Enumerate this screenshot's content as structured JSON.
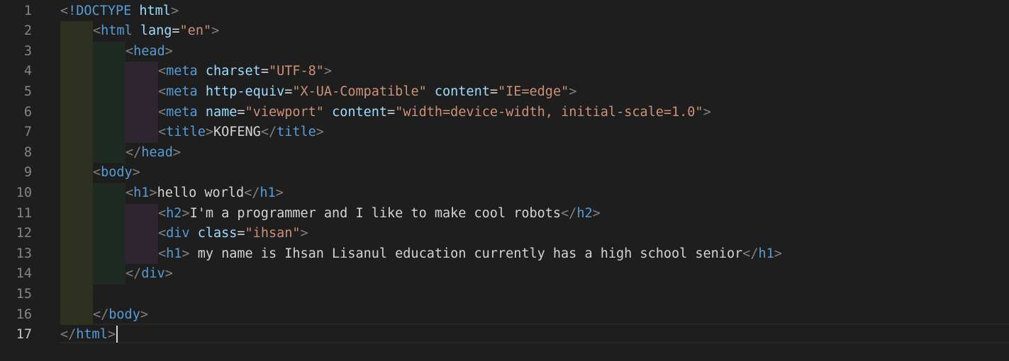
{
  "editor": {
    "line_numbers": [
      "1",
      "2",
      "3",
      "4",
      "5",
      "6",
      "7",
      "8",
      "9",
      "10",
      "11",
      "12",
      "13",
      "14",
      "15",
      "16",
      "17"
    ],
    "active_line": 17,
    "lines": [
      {
        "indent": 0,
        "tokens": [
          [
            "punc",
            "<"
          ],
          [
            "tag",
            "!DOCTYPE"
          ],
          [
            "text",
            " "
          ],
          [
            "attr",
            "html"
          ],
          [
            "punc",
            ">"
          ]
        ]
      },
      {
        "indent": 1,
        "tokens": [
          [
            "punc",
            "<"
          ],
          [
            "tag",
            "html"
          ],
          [
            "text",
            " "
          ],
          [
            "attr",
            "lang"
          ],
          [
            "text",
            "="
          ],
          [
            "str",
            "\"en\""
          ],
          [
            "punc",
            ">"
          ]
        ]
      },
      {
        "indent": 2,
        "tokens": [
          [
            "punc",
            "<"
          ],
          [
            "tag",
            "head"
          ],
          [
            "punc",
            ">"
          ]
        ]
      },
      {
        "indent": 3,
        "tokens": [
          [
            "punc",
            "<"
          ],
          [
            "tag",
            "meta"
          ],
          [
            "text",
            " "
          ],
          [
            "attr",
            "charset"
          ],
          [
            "text",
            "="
          ],
          [
            "str",
            "\"UTF-8\""
          ],
          [
            "punc",
            ">"
          ]
        ]
      },
      {
        "indent": 3,
        "tokens": [
          [
            "punc",
            "<"
          ],
          [
            "tag",
            "meta"
          ],
          [
            "text",
            " "
          ],
          [
            "attr",
            "http-equiv"
          ],
          [
            "text",
            "="
          ],
          [
            "str",
            "\"X-UA-Compatible\""
          ],
          [
            "text",
            " "
          ],
          [
            "attr",
            "content"
          ],
          [
            "text",
            "="
          ],
          [
            "str",
            "\"IE=edge\""
          ],
          [
            "punc",
            ">"
          ]
        ]
      },
      {
        "indent": 3,
        "tokens": [
          [
            "punc",
            "<"
          ],
          [
            "tag",
            "meta"
          ],
          [
            "text",
            " "
          ],
          [
            "attr",
            "name"
          ],
          [
            "text",
            "="
          ],
          [
            "str",
            "\"viewport\""
          ],
          [
            "text",
            " "
          ],
          [
            "attr",
            "content"
          ],
          [
            "text",
            "="
          ],
          [
            "str",
            "\"width=device-width, initial-scale=1.0\""
          ],
          [
            "punc",
            ">"
          ]
        ]
      },
      {
        "indent": 3,
        "tokens": [
          [
            "punc",
            "<"
          ],
          [
            "tag",
            "title"
          ],
          [
            "punc",
            ">"
          ],
          [
            "text",
            "KOFENG"
          ],
          [
            "punc",
            "</"
          ],
          [
            "tag",
            "title"
          ],
          [
            "punc",
            ">"
          ]
        ]
      },
      {
        "indent": 2,
        "tokens": [
          [
            "punc",
            "</"
          ],
          [
            "tag",
            "head"
          ],
          [
            "punc",
            ">"
          ]
        ]
      },
      {
        "indent": 1,
        "tokens": [
          [
            "punc",
            "<"
          ],
          [
            "tag",
            "body"
          ],
          [
            "punc",
            ">"
          ]
        ]
      },
      {
        "indent": 2,
        "tokens": [
          [
            "punc",
            "<"
          ],
          [
            "tag",
            "h1"
          ],
          [
            "punc",
            ">"
          ],
          [
            "text",
            "hello world"
          ],
          [
            "punc",
            "</"
          ],
          [
            "tag",
            "h1"
          ],
          [
            "punc",
            ">"
          ]
        ]
      },
      {
        "indent": 3,
        "tokens": [
          [
            "punc",
            "<"
          ],
          [
            "tag",
            "h2"
          ],
          [
            "punc",
            ">"
          ],
          [
            "text",
            "I'm a programmer and I like to make cool robots"
          ],
          [
            "punc",
            "</"
          ],
          [
            "tag",
            "h2"
          ],
          [
            "punc",
            ">"
          ]
        ]
      },
      {
        "indent": 3,
        "tokens": [
          [
            "punc",
            "<"
          ],
          [
            "tag",
            "div"
          ],
          [
            "text",
            " "
          ],
          [
            "attr",
            "class"
          ],
          [
            "text",
            "="
          ],
          [
            "str",
            "\"ihsan\""
          ],
          [
            "punc",
            ">"
          ]
        ]
      },
      {
        "indent": 3,
        "tokens": [
          [
            "punc",
            "<"
          ],
          [
            "tag",
            "h1"
          ],
          [
            "punc",
            ">"
          ],
          [
            "text",
            " my name is Ihsan Lisanul education currently has a high school senior"
          ],
          [
            "punc",
            "</"
          ],
          [
            "tag",
            "h1"
          ],
          [
            "punc",
            ">"
          ]
        ]
      },
      {
        "indent": 2,
        "tokens": [
          [
            "punc",
            "</"
          ],
          [
            "tag",
            "div"
          ],
          [
            "punc",
            ">"
          ]
        ]
      },
      {
        "indent": 0,
        "tokens": []
      },
      {
        "indent": 1,
        "tokens": [
          [
            "punc",
            "</"
          ],
          [
            "tag",
            "body"
          ],
          [
            "punc",
            ">"
          ]
        ]
      },
      {
        "indent": 0,
        "tokens": [
          [
            "punc",
            "</"
          ],
          [
            "tag",
            "html"
          ],
          [
            "punc",
            ">"
          ]
        ]
      }
    ],
    "colors": {
      "background": "#1e1e1e",
      "tag": "#569cd6",
      "attribute": "#9cdcfe",
      "string": "#ce9178",
      "text": "#d4d4d4",
      "punctuation": "#808080",
      "line_number": "#858585"
    }
  }
}
